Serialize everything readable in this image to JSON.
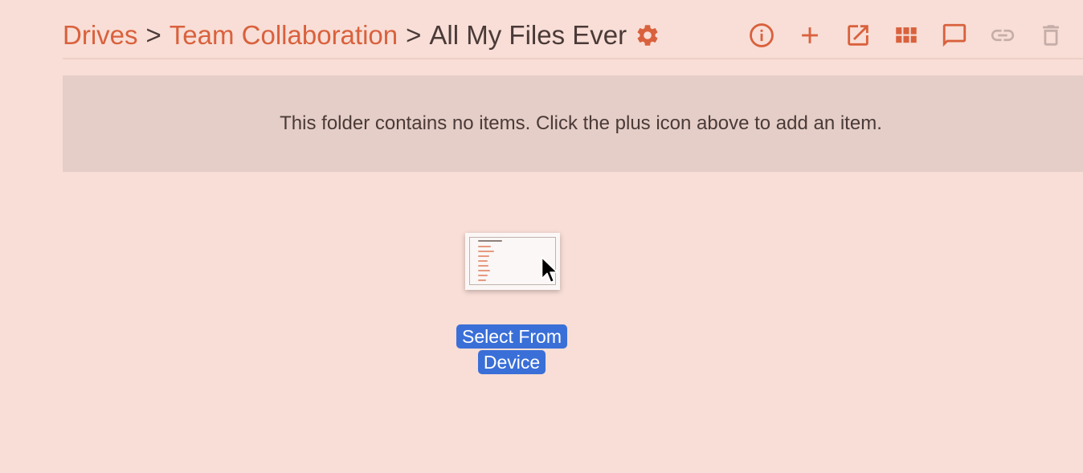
{
  "breadcrumb": {
    "items": [
      "Drives",
      "Team Collaboration"
    ],
    "separator": ">",
    "current": "All My Files Ever"
  },
  "icons": {
    "settings": "gear-icon",
    "info": "info-icon",
    "add": "plus-icon",
    "open_external": "open-external-icon",
    "view": "grid-view-icon",
    "comments": "comment-icon",
    "share_link": "link-icon",
    "delete": "trash-icon"
  },
  "empty_state": {
    "message": "This folder contains no items. Click the plus icon above to add an item."
  },
  "drop_target": {
    "label": "Select From Device"
  },
  "colors": {
    "background": "#f8ded6",
    "accent": "#d9613d",
    "text": "#4a3a38",
    "banner": "#e5cec7",
    "disabled": "#c6aea8",
    "button": "#3a6fd8"
  }
}
